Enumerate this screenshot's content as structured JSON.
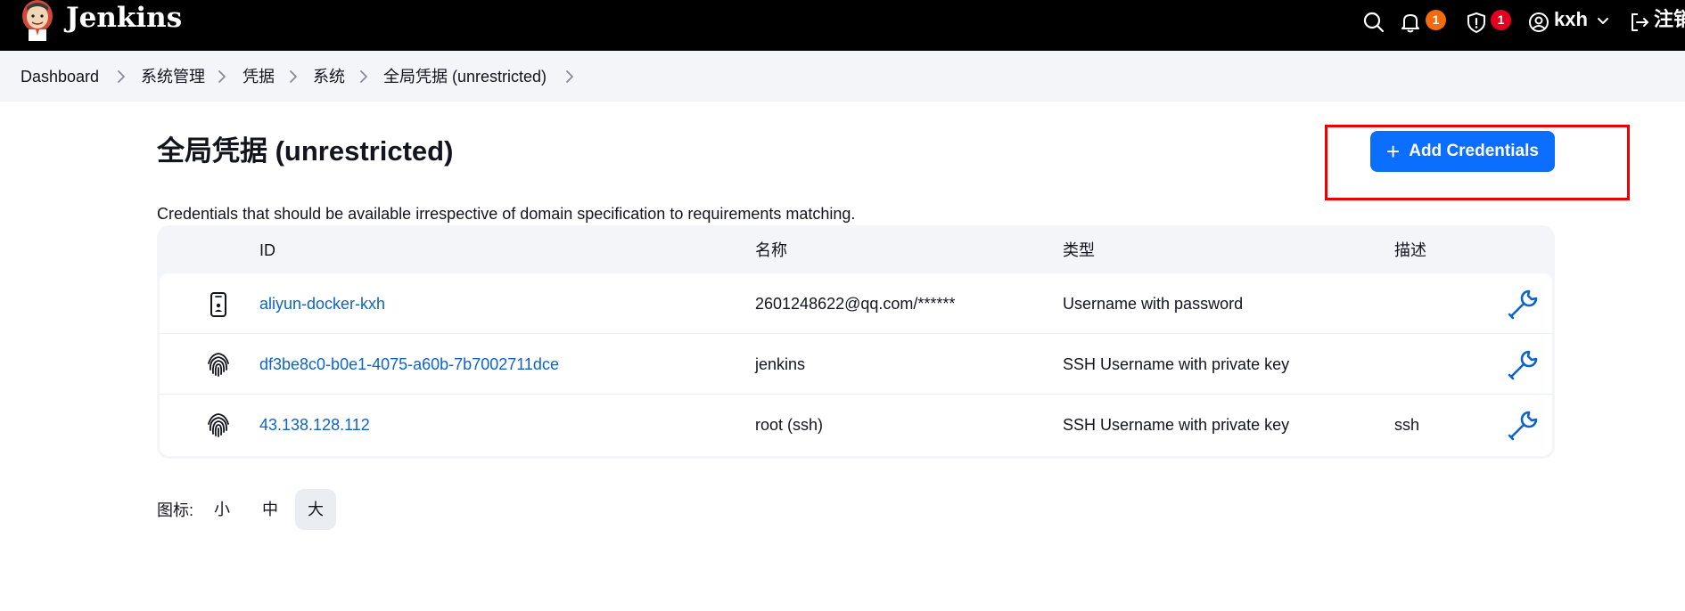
{
  "header": {
    "brand": "Jenkins",
    "notifications_count": "1",
    "security_count": "1",
    "user": "kxh",
    "logout_label": "注销",
    "icons": [
      "jenkins-logo-icon",
      "search-icon",
      "bell-icon",
      "shield-icon",
      "user-icon",
      "chevron-down-icon",
      "logout-icon"
    ],
    "colors": {
      "bar": "#000000",
      "notification_badge": "#f46b0b",
      "security_badge": "#e6001f"
    }
  },
  "breadcrumb": [
    "Dashboard",
    "系统管理",
    "凭据",
    "系统",
    "全局凭据 (unrestricted)"
  ],
  "page": {
    "title": "全局凭据 (unrestricted)",
    "add_button": "Add Credentials",
    "description": "Credentials that should be available irrespective of domain specification to requirements matching.",
    "accent": "#0b6efd"
  },
  "table": {
    "headers": [
      "ID",
      "名称",
      "类型",
      "描述"
    ],
    "rows": [
      {
        "icon": "mobile-card-icon",
        "id": "aliyun-docker-kxh",
        "name": "2601248622@qq.com/******",
        "type": "Username with password",
        "description": ""
      },
      {
        "icon": "fingerprint-icon",
        "id": "df3be8c0-b0e1-4075-a60b-7b7002711dce",
        "name": "jenkins",
        "type": "SSH Username with private key",
        "description": ""
      },
      {
        "icon": "fingerprint-icon",
        "id": "43.138.128.112",
        "name": "root (ssh)",
        "type": "SSH Username with private key",
        "description": "ssh"
      }
    ],
    "action_icon": "wrench-icon",
    "link_color": "#0d64c8"
  },
  "icon_size": {
    "label": "图标:",
    "options": [
      "小",
      "中",
      "大"
    ],
    "selected": "大"
  }
}
